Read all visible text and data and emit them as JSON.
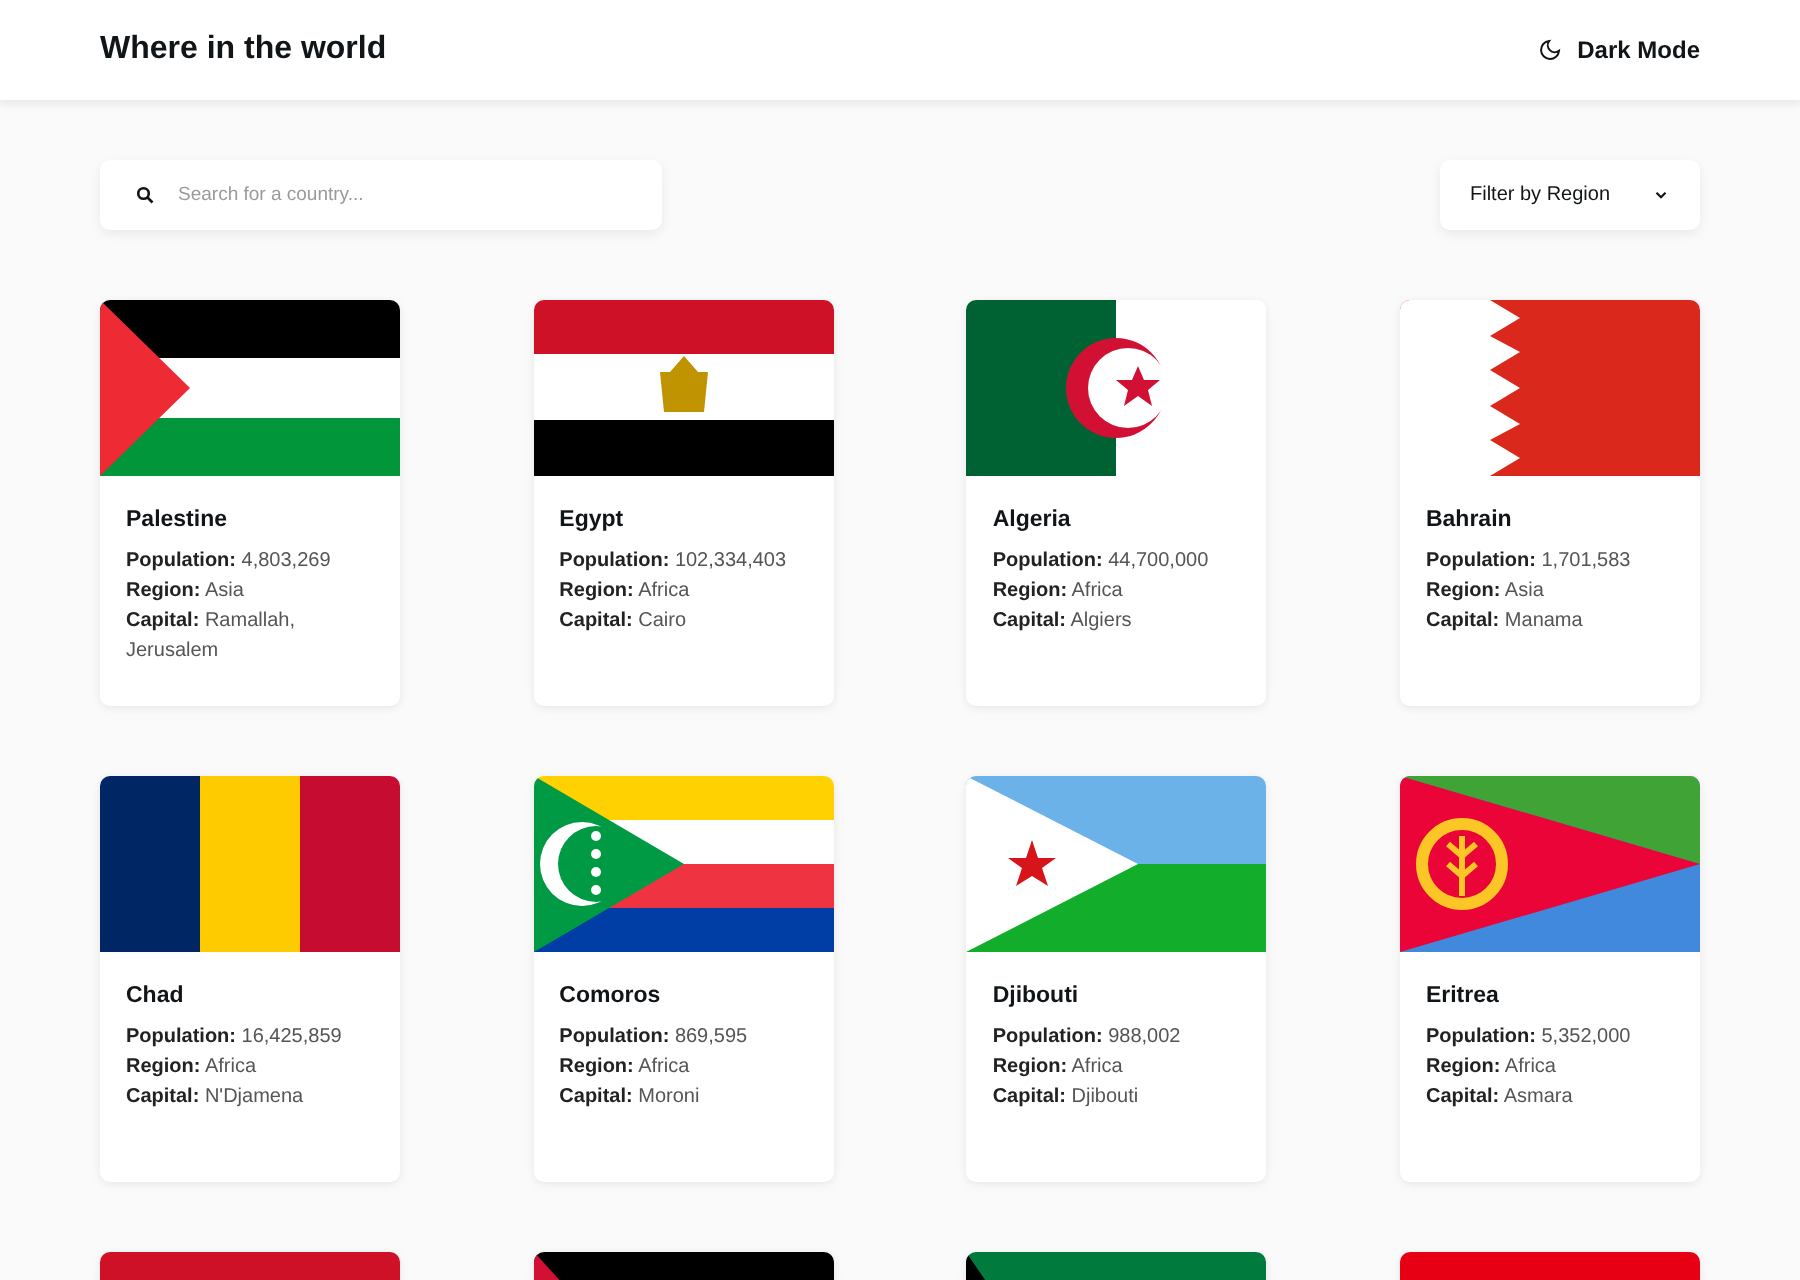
{
  "header": {
    "title": "Where in the world",
    "theme_toggle": "Dark Mode"
  },
  "search": {
    "placeholder": "Search for a country..."
  },
  "filter": {
    "label": "Filter by Region"
  },
  "countries": [
    {
      "kind": "palestine",
      "name": "Palestine",
      "population": {
        "label": "Population:",
        "value": "4,803,269"
      },
      "region": {
        "label": "Region:",
        "value": "Asia"
      },
      "capital": {
        "label": "Capital:",
        "value": "Ramallah, Jerusalem"
      }
    },
    {
      "kind": "egypt",
      "name": "Egypt",
      "population": {
        "label": "Population:",
        "value": "102,334,403"
      },
      "region": {
        "label": "Region:",
        "value": "Africa"
      },
      "capital": {
        "label": "Capital:",
        "value": "Cairo"
      }
    },
    {
      "kind": "algeria",
      "name": "Algeria",
      "population": {
        "label": "Population:",
        "value": "44,700,000"
      },
      "region": {
        "label": "Region:",
        "value": "Africa"
      },
      "capital": {
        "label": "Capital:",
        "value": "Algiers"
      }
    },
    {
      "kind": "bahrain",
      "name": "Bahrain",
      "population": {
        "label": "Population:",
        "value": "1,701,583"
      },
      "region": {
        "label": "Region:",
        "value": "Asia"
      },
      "capital": {
        "label": "Capital:",
        "value": "Manama"
      }
    },
    {
      "kind": "chad",
      "name": "Chad",
      "population": {
        "label": "Population:",
        "value": "16,425,859"
      },
      "region": {
        "label": "Region:",
        "value": "Africa"
      },
      "capital": {
        "label": "Capital:",
        "value": "N'Djamena"
      }
    },
    {
      "kind": "comoros",
      "name": "Comoros",
      "population": {
        "label": "Population:",
        "value": "869,595"
      },
      "region": {
        "label": "Region:",
        "value": "Africa"
      },
      "capital": {
        "label": "Capital:",
        "value": "Moroni"
      }
    },
    {
      "kind": "djibouti",
      "name": "Djibouti",
      "population": {
        "label": "Population:",
        "value": "988,002"
      },
      "region": {
        "label": "Region:",
        "value": "Africa"
      },
      "capital": {
        "label": "Capital:",
        "value": "Djibouti"
      }
    },
    {
      "kind": "eritrea",
      "name": "Eritrea",
      "population": {
        "label": "Population:",
        "value": "5,352,000"
      },
      "region": {
        "label": "Region:",
        "value": "Africa"
      },
      "capital": {
        "label": "Capital:",
        "value": "Asmara"
      }
    }
  ],
  "partial_cards": [
    {
      "kind": "crimson"
    },
    {
      "kind": "blackred"
    },
    {
      "kind": "greenblack"
    },
    {
      "kind": "scarlet"
    }
  ]
}
